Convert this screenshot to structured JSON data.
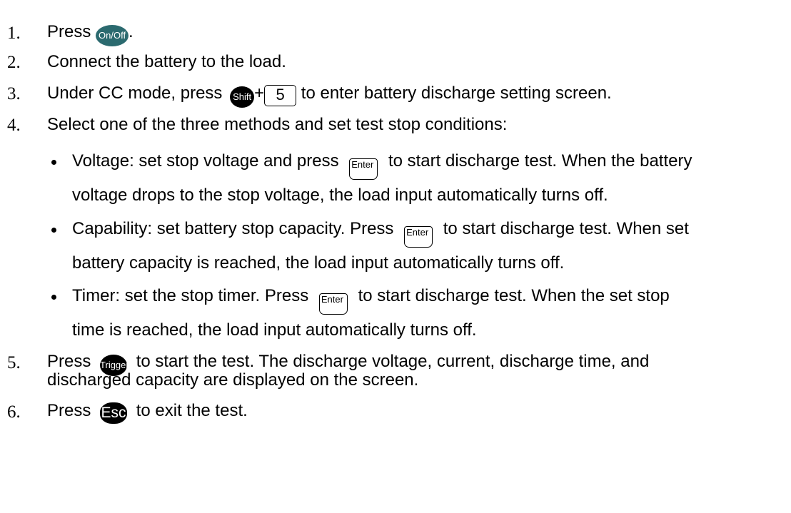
{
  "steps": [
    {
      "num": "1.",
      "before": "Press",
      "key": "On/Off",
      "after": "."
    },
    {
      "num": "2.",
      "text": "Connect the battery to the load."
    },
    {
      "num": "3.",
      "before": "Under CC mode, press",
      "key1": "Shift",
      "plus": "+",
      "key2": "5",
      "after": "to enter battery discharge setting screen."
    },
    {
      "num": "4.",
      "text": "Select one of the three methods and set test stop conditions:"
    },
    {
      "num": "5.",
      "before": "Press",
      "key": "Trigger",
      "after": "to start the test. The discharge voltage, current, discharge time, and",
      "line2": "discharged capacity are displayed on the screen."
    },
    {
      "num": "6.",
      "before": "Press",
      "key": "Esc",
      "after": "to exit the test."
    }
  ],
  "bullets": [
    {
      "before": "Voltage: set stop voltage and press",
      "key": "Enter",
      "after": "to start discharge test. When the battery",
      "line2": "voltage drops to the stop voltage, the load input automatically turns off."
    },
    {
      "before": "Capability: set battery stop capacity. Press",
      "key": "Enter",
      "after": "to start discharge test. When set",
      "line2": "battery capacity is reached, the load input automatically turns off."
    },
    {
      "before": "Timer: set the stop timer. Press",
      "key": "Enter",
      "after": "to start discharge test. When the set stop",
      "line2": "time is reached, the load input automatically turns off."
    }
  ],
  "colors": {
    "onoff_key": "#2b6a6f",
    "black_key": "#000000"
  }
}
